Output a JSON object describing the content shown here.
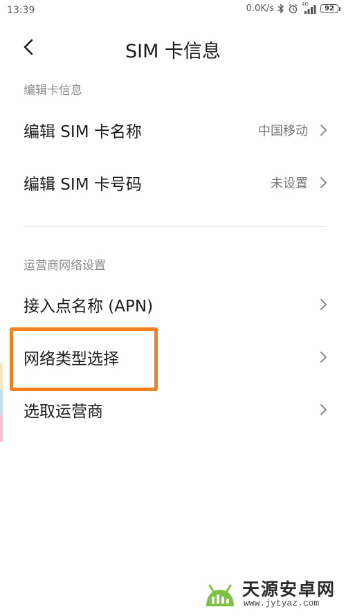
{
  "status_bar": {
    "time": "13:39",
    "net_speed": "0.0K/s",
    "network_type": "4G",
    "battery": "92"
  },
  "header": {
    "title": "SIM 卡信息"
  },
  "sections": [
    {
      "header": "编辑卡信息",
      "items": [
        {
          "label": "编辑 SIM 卡名称",
          "value": "中国移动"
        },
        {
          "label": "编辑 SIM 卡号码",
          "value": "未设置"
        }
      ]
    },
    {
      "header": "运营商网络设置",
      "items": [
        {
          "label": "接入点名称 (APN)"
        },
        {
          "label": "网络类型选择"
        },
        {
          "label": "选取运营商"
        }
      ]
    }
  ],
  "highlight": {
    "color": "#f47f20"
  },
  "watermark": {
    "title": "天源安卓网",
    "url": "www.jytyaz.com"
  }
}
